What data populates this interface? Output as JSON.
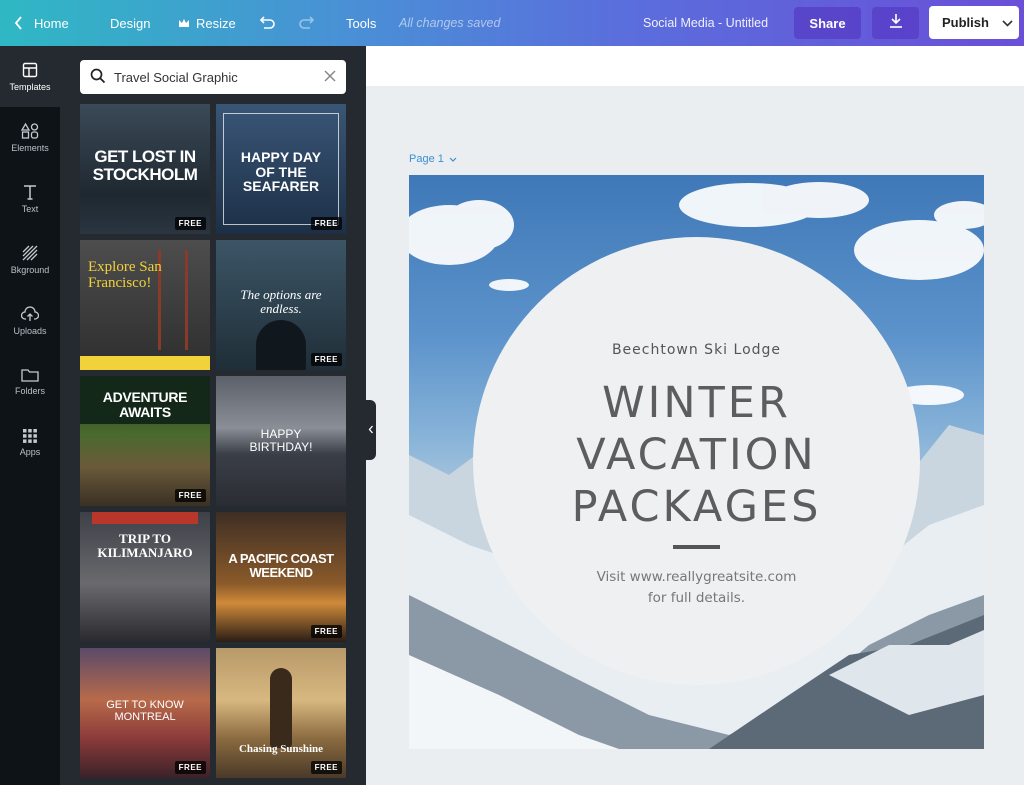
{
  "topbar": {
    "home": "Home",
    "design": "Design",
    "resize": "Resize",
    "tools": "Tools",
    "saved_status": "All changes saved",
    "doc_title": "Social Media - Untitled",
    "share": "Share",
    "publish": "Publish"
  },
  "rail": {
    "items": [
      {
        "label": "Templates",
        "icon": "templates-icon"
      },
      {
        "label": "Elements",
        "icon": "elements-icon"
      },
      {
        "label": "Text",
        "icon": "text-icon"
      },
      {
        "label": "Bkground",
        "icon": "background-icon"
      },
      {
        "label": "Uploads",
        "icon": "uploads-icon"
      },
      {
        "label": "Folders",
        "icon": "folders-icon"
      },
      {
        "label": "Apps",
        "icon": "apps-icon"
      }
    ]
  },
  "search": {
    "value": "Travel Social Graphic"
  },
  "templates": [
    {
      "title": "GET LOST IN STOCKHOLM",
      "badge": "FREE",
      "color": "#2d3a48"
    },
    {
      "title": "HAPPY DAY OF THE SEAFARER",
      "badge": "FREE",
      "color": "#1f3553"
    },
    {
      "title": "Explore San Francisco!",
      "badge": "",
      "color": "#3a3a3a"
    },
    {
      "title": "The options are endless.",
      "badge": "FREE",
      "color": "#2a3d4a"
    },
    {
      "title": "ADVENTURE AWAITS",
      "badge": "FREE",
      "color": "#2c3d22"
    },
    {
      "title": "HAPPY BIRTHDAY!",
      "badge": "",
      "color": "#5a5e66"
    },
    {
      "title": "TRIP TO KILIMANJARO",
      "badge": "",
      "color": "#4a4a4e"
    },
    {
      "title": "A PACIFIC COAST WEEKEND",
      "badge": "FREE",
      "color": "#3d2a1e"
    },
    {
      "title": "GET TO KNOW MONTREAL",
      "badge": "FREE",
      "color": "#6a3a3e"
    },
    {
      "title": "Chasing Sunshine",
      "badge": "FREE",
      "color": "#8a6a3a"
    }
  ],
  "canvas": {
    "page_label": "Page 1",
    "brand": "Beechtown Ski Lodge",
    "headline": "WINTER VACATION PACKAGES",
    "footer_line1": "Visit www.reallygreatsite.com",
    "footer_line2": "for full details."
  }
}
